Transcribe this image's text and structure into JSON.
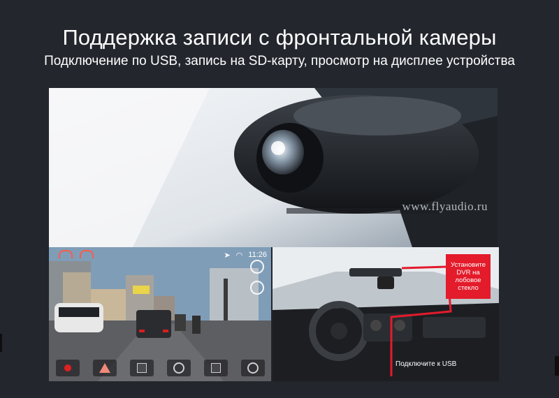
{
  "header": {
    "title": "Поддержка записи с фронтальной камеры",
    "subtitle": "Подключение по USB, запись на SD-карту, просмотр на дисплее устройства"
  },
  "top_photo": {
    "watermark": "www.flyaudio.ru"
  },
  "dvr_screen": {
    "time": "11:26",
    "toolbar": [
      {
        "icon": "record-icon"
      },
      {
        "icon": "warning-icon"
      },
      {
        "icon": "calendar-icon"
      },
      {
        "icon": "rotate-icon"
      },
      {
        "icon": "save-icon"
      },
      {
        "icon": "settings-icon"
      }
    ]
  },
  "interior_photo": {
    "install_badge": "Установите DVR на лобовое стекло",
    "usb_label": "Подключите к USB",
    "accent_color": "#e31b2b"
  }
}
